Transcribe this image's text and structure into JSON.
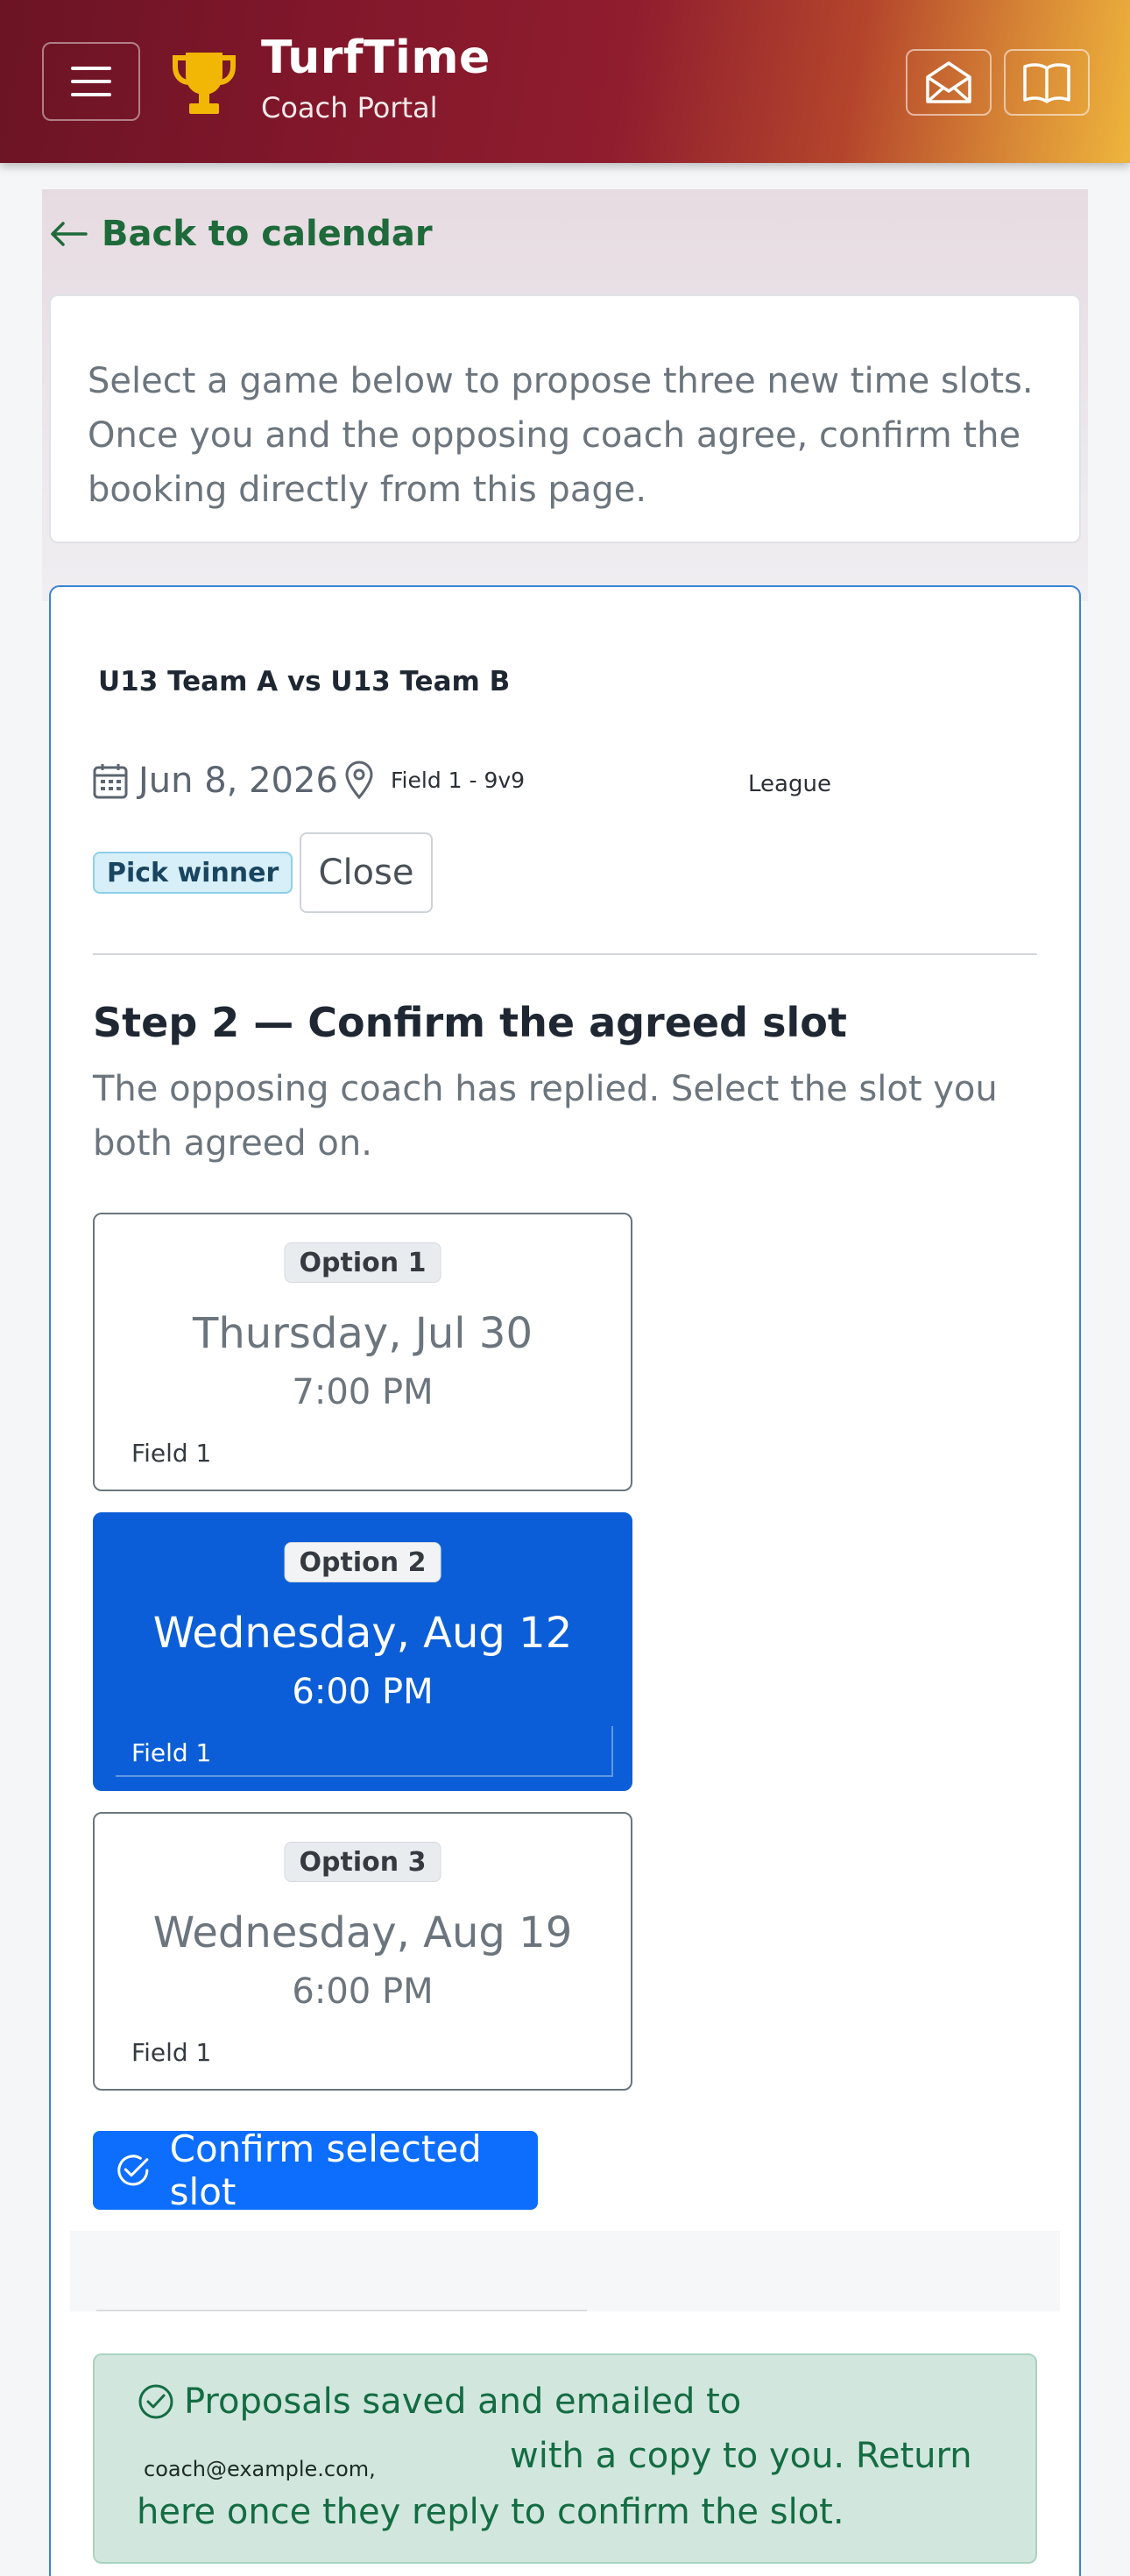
{
  "header": {
    "brand_title": "TurfTime",
    "brand_subtitle": "Coach Portal",
    "menu_icon": "hamburger-menu-icon",
    "trophy_icon": "trophy-icon",
    "inbox_icon": "envelope-open-icon",
    "guide_icon": "open-book-icon"
  },
  "nav": {
    "back_label": "Back to calendar"
  },
  "intro": {
    "text": "Select a game below to propose three new time slots. Once you and the opposing coach agree, confirm the booking directly from this page."
  },
  "game": {
    "title": "U13 Team A vs U13 Team B",
    "date": "Jun 8, 2026",
    "field": "Field 1 - 9v9",
    "type": "League",
    "badge": "Pick winner",
    "close_label": "Close"
  },
  "step2": {
    "title": "Step 2 — Confirm the agreed slot",
    "description": "The opposing coach has replied. Select the slot you both agreed on.",
    "options": [
      {
        "label": "Option 1",
        "date": "Thursday, Jul 30",
        "time": "7:00 PM",
        "field": "Field 1",
        "selected": false
      },
      {
        "label": "Option 2",
        "date": "Wednesday, Aug 12",
        "time": "6:00 PM",
        "field": "Field 1",
        "selected": true
      },
      {
        "label": "Option 3",
        "date": "Wednesday, Aug 19",
        "time": "6:00 PM",
        "field": "Field 1",
        "selected": false
      }
    ],
    "confirm_label": "Confirm selected slot"
  },
  "alert": {
    "line1": "Proposals saved and emailed to",
    "email": "coach@example.com,",
    "line2": "with a copy to you. Return",
    "line3": "here once they reply to confirm the slot."
  },
  "colors": {
    "accent_green": "#1e6a3a",
    "primary_blue": "#0d6efd",
    "selected_blue": "#0b5ed7",
    "alert_bg": "#d1e7dd"
  }
}
